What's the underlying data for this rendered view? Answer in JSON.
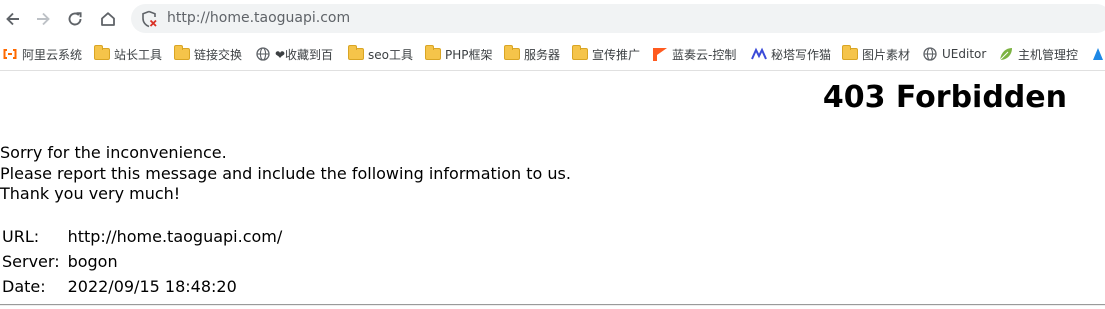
{
  "browser": {
    "url": "http://home.taoguapi.com",
    "bookmarks": [
      {
        "label": "阿里云系统",
        "icon": "aliyun-icon"
      },
      {
        "label": "站长工具",
        "icon": "folder-icon"
      },
      {
        "label": "链接交换",
        "icon": "folder-icon"
      },
      {
        "label": "❤收藏到百",
        "icon": "globe-icon"
      },
      {
        "label": "seo工具",
        "icon": "folder-icon"
      },
      {
        "label": "PHP框架",
        "icon": "folder-icon"
      },
      {
        "label": "服务器",
        "icon": "folder-icon"
      },
      {
        "label": "宣传推广",
        "icon": "folder-icon"
      },
      {
        "label": "蓝奏云-控制",
        "icon": "lanzou-icon"
      },
      {
        "label": "秘塔写作猫",
        "icon": "mita-icon"
      },
      {
        "label": "图片素材",
        "icon": "folder-icon"
      },
      {
        "label": "UEditor",
        "icon": "globe-icon"
      },
      {
        "label": "主机管理控",
        "icon": "leaf-icon"
      }
    ]
  },
  "page": {
    "title": "403 Forbidden",
    "messages": [
      "Sorry for the inconvenience.",
      "Please report this message and include the following information to us.",
      "Thank you very much!"
    ],
    "info": [
      {
        "key": "URL:",
        "value": "http://home.taoguapi.com/"
      },
      {
        "key": "Server:",
        "value": "bogon"
      },
      {
        "key": "Date:",
        "value": "2022/09/15 18:48:20"
      }
    ]
  },
  "colors": {
    "folder": "#f5c44a",
    "aliyun": "#ff6a00",
    "lanzou": "#ff5a1f",
    "mita": "#3b4bd8",
    "leaf": "#7cb342"
  }
}
